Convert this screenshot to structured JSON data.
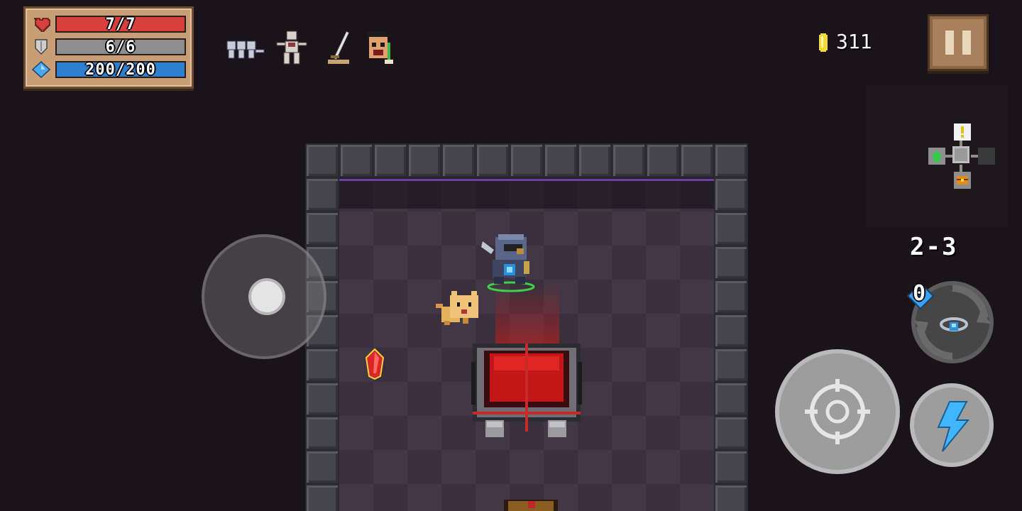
{
  "hud": {
    "hp_text": "7/7",
    "hp_fraction": 1.0,
    "armor_text": "6/6",
    "armor_fraction": 1.0,
    "energy_text": "200/200",
    "energy_fraction": 1.0,
    "gold": "311",
    "level": "2-3",
    "weapon_energy_cost": "0"
  },
  "buffs": [
    {
      "icon": "skeleton-trio-icon"
    },
    {
      "icon": "skeleton-dancer-icon"
    },
    {
      "icon": "sword-in-stone-icon"
    },
    {
      "icon": "warrior-face-icon"
    }
  ],
  "minimap": {
    "rooms": [
      "exclamation-room",
      "start-room",
      "current-room",
      "unexplored-room",
      "chest-room"
    ]
  },
  "colors": {
    "hp": "#d8403d",
    "armor": "#8d8d8d",
    "energy": "#2f7fcf",
    "gold": "#f5d83a",
    "skill": "#3fb6ff"
  }
}
